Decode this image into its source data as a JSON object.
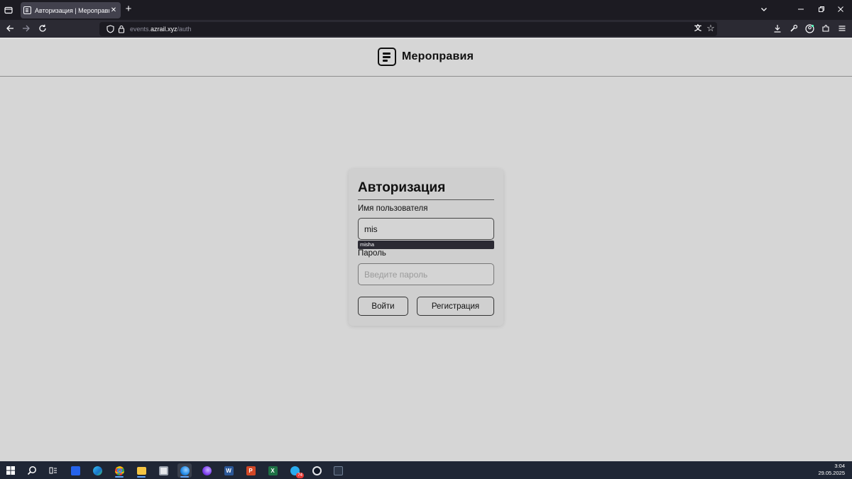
{
  "browser": {
    "tab_title": "Авторизация | Мероправия",
    "tab_close": "✕",
    "new_tab": "+",
    "url_prefix": "events.",
    "url_host": "azrail.xyz",
    "url_path": "/auth",
    "icons": [
      "tab-list-icon",
      "back-icon",
      "forward-icon",
      "reload-icon",
      "shield-icon",
      "lock-icon",
      "translate-icon",
      "bookmark-star-icon",
      "download-icon",
      "wrench-icon",
      "account-icon",
      "extensions-icon",
      "menu-icon",
      "tab-overflow-icon",
      "minimize-icon",
      "restore-icon",
      "close-window-icon"
    ]
  },
  "site": {
    "brand_name": "Мероправия",
    "logo_icon": "list-box-icon"
  },
  "auth": {
    "title": "Авторизация",
    "username_label": "Имя пользователя",
    "username_value": "mis",
    "autocomplete_suggestion": "misha",
    "password_label": "Пароль",
    "password_placeholder": "Введите пароль",
    "login_button": "Войти",
    "register_button": "Регистрация"
  },
  "taskbar": {
    "time": "3:04",
    "date": "29.05.2025",
    "apps": [
      "start-icon",
      "search-icon",
      "task-view-icon",
      "app-blue-icon",
      "edge-icon",
      "chrome-icon",
      "file-explorer-icon",
      "store-icon",
      "firefox-icon",
      "firefox-dev-icon",
      "word-icon",
      "powerpoint-icon",
      "excel-icon",
      "telegram-icon",
      "speedometer-icon",
      "davinci-icon"
    ],
    "telegram_badge": "74"
  },
  "colors": {
    "page_bg": "#d6d6d6",
    "card_bg": "#cfcfcf",
    "chrome_dark": "#1c1b22",
    "taskbar": "#1f2635"
  }
}
